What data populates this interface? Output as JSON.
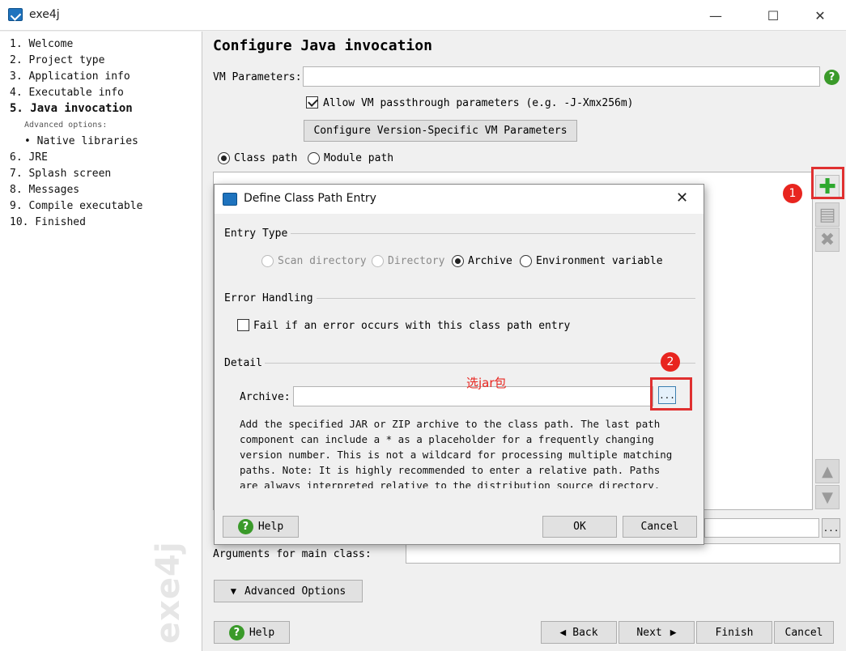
{
  "window": {
    "title": "exe4j",
    "minimize": "—",
    "maximize": "☐",
    "close": "✕"
  },
  "sidebar": {
    "steps": [
      {
        "label": "1.  Welcome"
      },
      {
        "label": "2.  Project type"
      },
      {
        "label": "3.  Application info"
      },
      {
        "label": "4.  Executable info"
      },
      {
        "label": "5.  Java invocation"
      },
      {
        "label": "Advanced options:"
      },
      {
        "label": "• Native libraries"
      },
      {
        "label": "6.  JRE"
      },
      {
        "label": "7.  Splash screen"
      },
      {
        "label": "8.  Messages"
      },
      {
        "label": "9.  Compile executable"
      },
      {
        "label": "10.  Finished"
      }
    ],
    "watermark": "exe4j"
  },
  "main": {
    "title": "Configure Java invocation",
    "vm_params_label": "VM Parameters:",
    "vm_params_value": "",
    "allow_passthrough_label": "Allow VM passthrough parameters (e.g. -J-Xmx256m)",
    "version_specific_button": "Configure Version-Specific VM Parameters",
    "class_path_label": "Class path",
    "module_path_label": "Module path",
    "arguments_label": "Arguments for main class:",
    "advanced_options_button": "Advanced Options",
    "browse_label": "...",
    "help_button": "Help",
    "back_button": "Back",
    "next_button": "Next",
    "finish_button": "Finish",
    "cancel_button": "Cancel"
  },
  "annotations": {
    "badge1": "1",
    "badge2": "2",
    "note": "选jar包"
  },
  "dialog": {
    "title": "Define Class Path Entry",
    "close": "✕",
    "entry_type_label": "Entry Type",
    "entry_types": [
      "Scan directory",
      "Directory",
      "Archive",
      "Environment variable"
    ],
    "error_handling_label": "Error Handling",
    "fail_label": "Fail if an error occurs with this class path entry",
    "detail_label": "Detail",
    "archive_label": "Archive:",
    "archive_value": "",
    "browse_label": "...",
    "description": [
      "Add the specified JAR or ZIP archive to the class path. The last path",
      "component can include a * as a placeholder for a frequently changing",
      "version number. This is not a wildcard for processing multiple matching",
      "paths. Note: It is highly recommended to enter a relative path. Paths",
      "are always interpreted relative to the distribution source directory."
    ],
    "help_button": "Help",
    "ok_button": "OK",
    "cancel_button": "Cancel"
  },
  "colors": {
    "accent_red": "#e03030",
    "help_green": "#3a9a2a",
    "plus_green": "#2fa82f"
  }
}
